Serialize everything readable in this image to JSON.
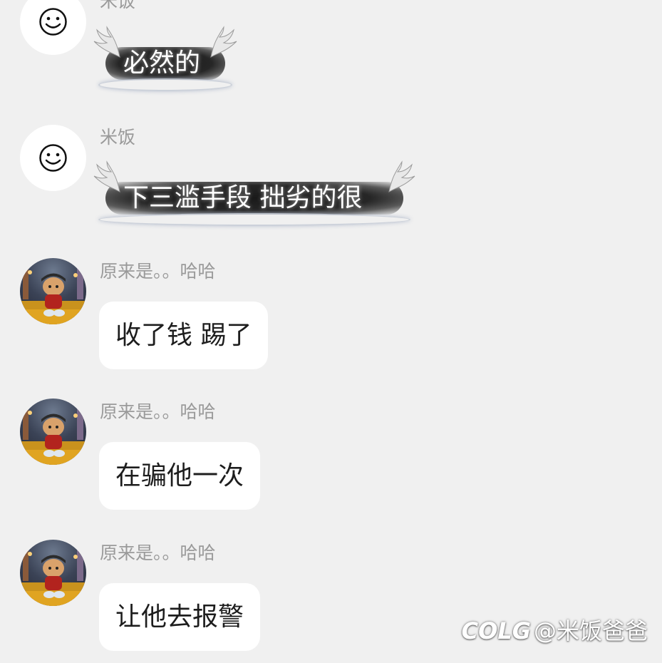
{
  "messages": [
    {
      "sender": "米饭",
      "text": "必然的",
      "style": "wing",
      "avatar": "smile-face-icon"
    },
    {
      "sender": "米饭",
      "text": "下三滥手段 拙劣的很",
      "style": "wing",
      "avatar": "smile-face-icon"
    },
    {
      "sender": "原来是。。哈哈",
      "text": "收了钱 踢了",
      "style": "plain",
      "avatar": "cat-photo-avatar"
    },
    {
      "sender": "原来是。。哈哈",
      "text": "在骗他一次",
      "style": "plain",
      "avatar": "cat-photo-avatar"
    },
    {
      "sender": "原来是。。哈哈",
      "text": "让他去报警",
      "style": "plain",
      "avatar": "cat-photo-avatar"
    }
  ],
  "watermark": {
    "logo": "COLG",
    "handle": "@米饭爸爸"
  },
  "colors": {
    "background": "#f0f0f0",
    "bubble": "#ffffff",
    "sender_text": "#9a9a9a",
    "message_text": "#1d1d1d"
  }
}
